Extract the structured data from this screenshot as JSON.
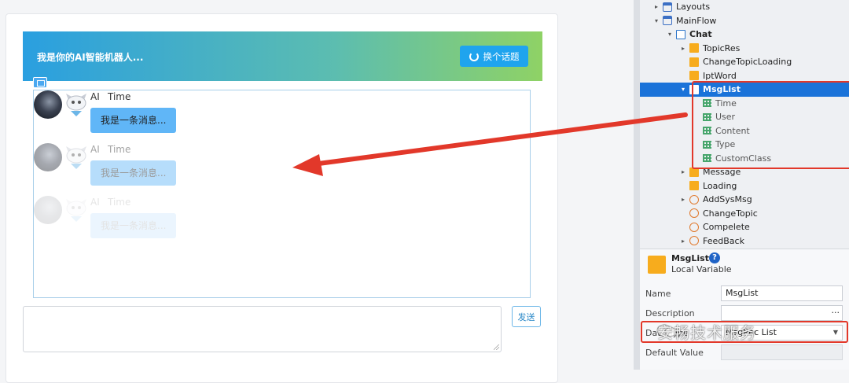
{
  "preview": {
    "header_title": "我是你的AI智能机器人...",
    "change_topic_label": "换个话题",
    "messages": [
      {
        "user": "AI",
        "time": "Time",
        "content": "我是一条消息...",
        "opacity": 1.0
      },
      {
        "user": "AI",
        "time": "Time",
        "content": "我是一条消息...",
        "opacity": 0.45
      },
      {
        "user": "AI",
        "time": "Time",
        "content": "我是一条消息...",
        "opacity": 0.12
      }
    ],
    "input_placeholder": "",
    "send_label": "发送"
  },
  "tree": [
    {
      "label": "Layouts",
      "indent": 1,
      "caret": "▸",
      "icon": "folder-icon",
      "style": ""
    },
    {
      "label": "MainFlow",
      "indent": 1,
      "caret": "▾",
      "icon": "folder-icon",
      "style": ""
    },
    {
      "label": "Chat",
      "indent": 2,
      "caret": "▾",
      "icon": "home-icon",
      "style": "bold"
    },
    {
      "label": "TopicRes",
      "indent": 3,
      "caret": "▸",
      "icon": "variable-icon",
      "style": ""
    },
    {
      "label": "ChangeTopicLoading",
      "indent": 3,
      "caret": "",
      "icon": "variable-icon",
      "style": ""
    },
    {
      "label": "IptWord",
      "indent": 3,
      "caret": "",
      "icon": "variable-icon",
      "style": ""
    },
    {
      "label": "MsgList",
      "indent": 3,
      "caret": "▾",
      "icon": "variable-white-icon",
      "style": "selected"
    },
    {
      "label": "Time",
      "indent": 4,
      "caret": "",
      "icon": "grid-icon",
      "style": "muted"
    },
    {
      "label": "User",
      "indent": 4,
      "caret": "",
      "icon": "grid-icon",
      "style": "muted"
    },
    {
      "label": "Content",
      "indent": 4,
      "caret": "",
      "icon": "grid-icon",
      "style": "muted"
    },
    {
      "label": "Type",
      "indent": 4,
      "caret": "",
      "icon": "grid-icon",
      "style": "muted"
    },
    {
      "label": "CustomClass",
      "indent": 4,
      "caret": "",
      "icon": "grid-icon",
      "style": "muted"
    },
    {
      "label": "Message",
      "indent": 3,
      "caret": "▸",
      "icon": "variable-icon",
      "style": ""
    },
    {
      "label": "Loading",
      "indent": 3,
      "caret": "",
      "icon": "variable-icon",
      "style": ""
    },
    {
      "label": "AddSysMsg",
      "indent": 3,
      "caret": "▸",
      "icon": "action-icon",
      "style": ""
    },
    {
      "label": "ChangeTopic",
      "indent": 3,
      "caret": "",
      "icon": "action-icon",
      "style": ""
    },
    {
      "label": "Compelete",
      "indent": 3,
      "caret": "",
      "icon": "action-icon",
      "style": ""
    },
    {
      "label": "FeedBack",
      "indent": 3,
      "caret": "▸",
      "icon": "action-icon",
      "style": ""
    }
  ],
  "properties": {
    "title": "MsgList",
    "help": "?",
    "subtitle": "Local Variable",
    "name_label": "Name",
    "name_value": "MsgList",
    "description_label": "Description",
    "description_value": "",
    "description_more": "...",
    "datatype_label": "Data Type",
    "datatype_value": "MsgRec List",
    "default_label": "Default Value",
    "default_value": ""
  },
  "watermark": "安畅技术服务",
  "colors": {
    "selection": "#1a73d9",
    "annotation_red": "#e2382a",
    "variable_orange": "#f7ac1d",
    "action_orange": "#e07a2e",
    "header_start": "#2a9fe0",
    "header_end": "#8fd265",
    "bubble": "#60b6f7"
  }
}
